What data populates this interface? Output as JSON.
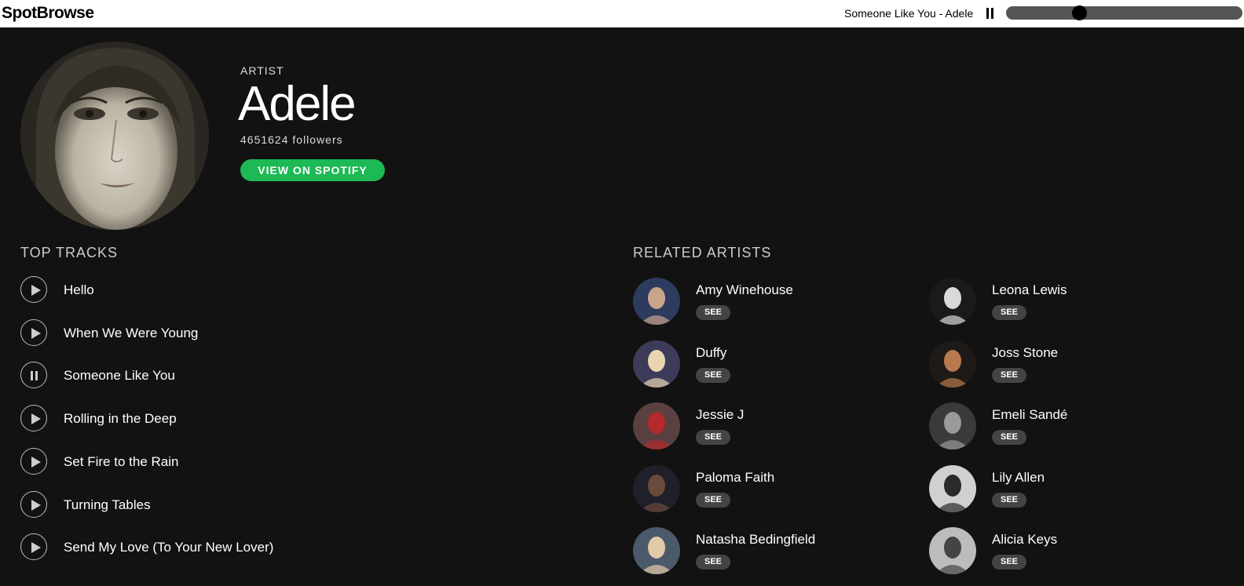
{
  "app": {
    "title": "SpotBrowse"
  },
  "player": {
    "now_playing": "Someone Like You - Adele",
    "progress": 0.31
  },
  "artist": {
    "type_label": "ARTIST",
    "name": "Adele",
    "followers": "4651624 followers",
    "spotify_button": "VIEW ON SPOTIFY"
  },
  "top_tracks": {
    "heading": "TOP TRACKS",
    "items": [
      {
        "title": "Hello",
        "state": "play"
      },
      {
        "title": "When We Were Young",
        "state": "play"
      },
      {
        "title": "Someone Like You",
        "state": "pause"
      },
      {
        "title": "Rolling in the Deep",
        "state": "play"
      },
      {
        "title": "Set Fire to the Rain",
        "state": "play"
      },
      {
        "title": "Turning Tables",
        "state": "play"
      },
      {
        "title": "Send My Love (To Your New Lover)",
        "state": "play"
      }
    ]
  },
  "related_artists": {
    "heading": "RELATED ARTISTS",
    "see_label": "SEE",
    "items": [
      {
        "name": "Amy Winehouse"
      },
      {
        "name": "Leona Lewis"
      },
      {
        "name": "Duffy"
      },
      {
        "name": "Joss Stone"
      },
      {
        "name": "Jessie J"
      },
      {
        "name": "Emeli Sandé"
      },
      {
        "name": "Paloma Faith"
      },
      {
        "name": "Lily Allen"
      },
      {
        "name": "Natasha Bedingfield"
      },
      {
        "name": "Alicia Keys"
      }
    ]
  },
  "colors": {
    "background": "#121212",
    "accent": "#1db954",
    "topbar": "#ffffff"
  }
}
